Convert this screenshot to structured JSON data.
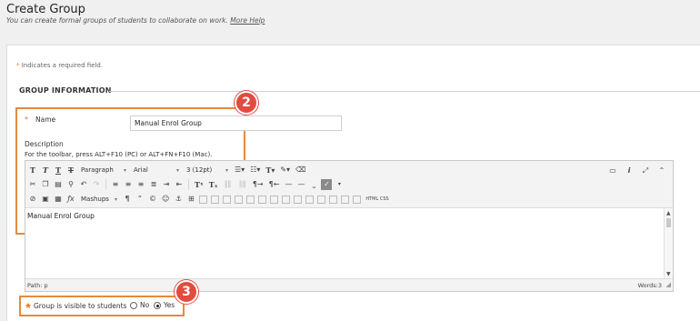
{
  "header": {
    "title": "Create Group",
    "subtitle": "You can create formal groups of students to collaborate on work.",
    "more_help": "More Help"
  },
  "form": {
    "required_note": "Indicates a required field.",
    "required_star": "*",
    "section_title": "GROUP INFORMATION",
    "name_label": "Name",
    "name_value": "Manual Enrol Group",
    "description_label": "Description",
    "toolbar_help": "For the toolbar, press ALT+F10 (PC) or ALT+FN+F10 (Mac).",
    "visible_label": "Group is visible to students",
    "visible_options": [
      "No",
      "Yes"
    ],
    "visible_selected": "Yes"
  },
  "editor": {
    "format_select": "Paragraph",
    "font_select": "Arial",
    "size_select": "3 (12pt)",
    "mashups": "Mashups",
    "html_css": "HTML CSS",
    "content": "Manual Enrol Group",
    "path": "Path: p",
    "words": "Words:3"
  },
  "callouts": {
    "badge_2": "2",
    "badge_3": "3",
    "highlight_color": "#e8893a",
    "badge_color": "#e24b3f"
  },
  "colors": {
    "required_star": "#e8742a"
  }
}
